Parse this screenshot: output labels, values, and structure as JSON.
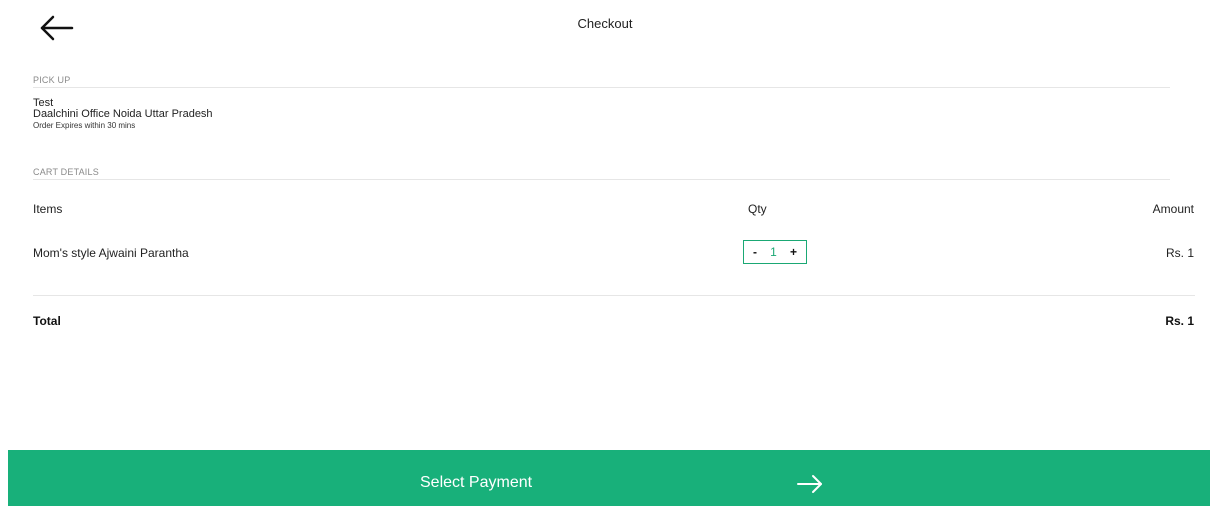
{
  "header": {
    "title": "Checkout",
    "back_icon": "arrow-left-icon"
  },
  "pickup": {
    "section_label": "PICK UP",
    "name": "Test",
    "address": "Daalchini Office Noida Uttar Pradesh",
    "expiry_note": "Order Expires within 30 mins"
  },
  "cart": {
    "section_label": "CART DETAILS",
    "columns": {
      "items": "Items",
      "qty": "Qty",
      "amount": "Amount"
    },
    "rows": [
      {
        "name": "Mom's style Ajwaini Parantha",
        "qty_minus": "-",
        "qty": "1",
        "qty_plus": "+",
        "amount": "Rs. 1"
      }
    ],
    "total_label": "Total",
    "total_amount": "Rs. 1"
  },
  "footer": {
    "pay_label": "Select Payment",
    "pay_icon": "arrow-right-icon",
    "accent_color": "#18b07a"
  }
}
